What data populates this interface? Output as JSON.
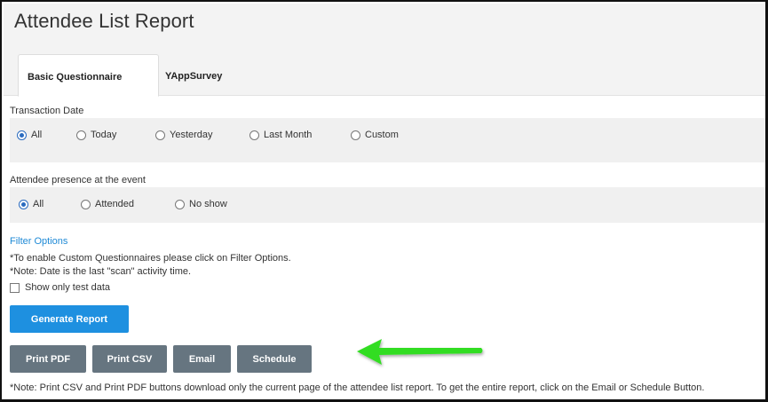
{
  "page": {
    "title": "Attendee List Report"
  },
  "tabs": [
    {
      "label": "Basic Questionnaire",
      "active": true
    },
    {
      "label": "YAppSurvey",
      "active": false
    }
  ],
  "transaction_date": {
    "label": "Transaction Date",
    "selected": "All",
    "options": [
      "All",
      "Today",
      "Yesterday",
      "Last Month",
      "Custom"
    ]
  },
  "presence": {
    "label": "Attendee presence at the event",
    "selected": "All",
    "options": [
      "All",
      "Attended",
      "No show"
    ]
  },
  "filter_options": {
    "link": "Filter Options",
    "note1": "*To enable Custom Questionnaires please click on Filter Options.",
    "note2": "*Note: Date is the last \"scan\" activity time."
  },
  "test_data": {
    "label": "Show only test data",
    "checked": false
  },
  "buttons": {
    "generate": "Generate Report",
    "print_pdf": "Print PDF",
    "print_csv": "Print CSV",
    "email": "Email",
    "schedule": "Schedule"
  },
  "footnote": "*Note: Print CSV and Print PDF buttons download only the current page of the attendee list report. To get the entire report, click on the Email or Schedule Button.",
  "colors": {
    "primary_button": "#1e90e0",
    "secondary_button": "#667580",
    "link": "#1f8ad6",
    "annotation_arrow": "#33dd22"
  },
  "icons": {
    "annotation": "green-arrow-icon"
  }
}
